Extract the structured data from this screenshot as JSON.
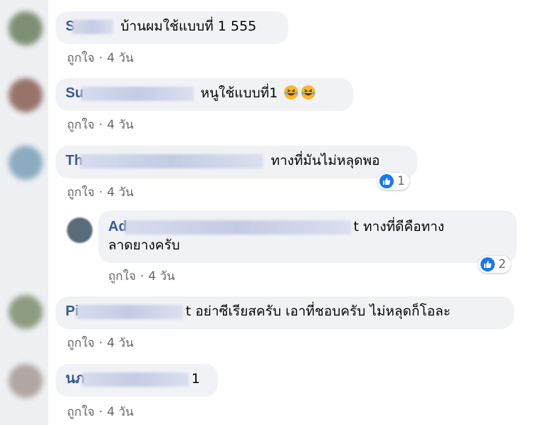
{
  "comments": [
    {
      "author": "S",
      "text": "บ้านผมใช้แบบที่ 1 555",
      "like_label": "ถูกใจ",
      "time": "4 วัน"
    },
    {
      "author": "Su",
      "text": "หนูใช้แบบที่1",
      "like_label": "ถูกใจ",
      "time": "4 วัน",
      "emoji": "rolling-laughing-icon"
    },
    {
      "author": "Th",
      "text": "ทางที่มันไม่หลุดพอ",
      "like_label": "ถูกใจ",
      "time": "4 วัน",
      "reaction_count": "1"
    },
    {
      "author": "Ad",
      "text_line1": "t ทางที่ดีคือทาง",
      "text_line2": "ลาดยางครับ",
      "like_label": "ถูกใจ",
      "time": "4 วัน",
      "reaction_count": "2"
    },
    {
      "author": "Pi",
      "text": "t อย่าซีเรียสครับ เอาที่ชอบครับ ไม่หลุดก็โอละ",
      "like_label": "ถูกใจ",
      "time": "4 วัน"
    },
    {
      "author": "นภ",
      "text": "1",
      "like_label": "ถูกใจ",
      "time": "4 วัน"
    }
  ],
  "colors": {
    "author": "#385898",
    "bubble": "#f0f2f5",
    "meta": "#65676b",
    "like_blue": "#1877f2"
  }
}
